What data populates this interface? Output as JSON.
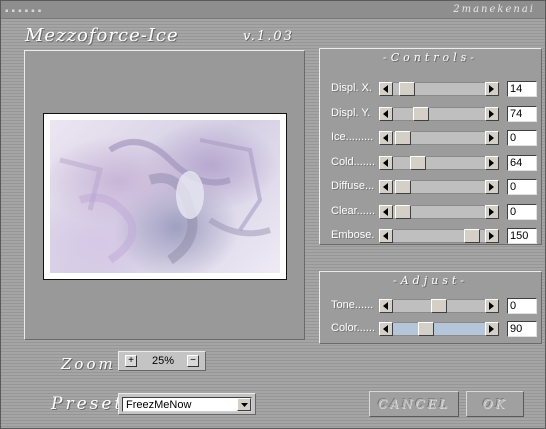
{
  "window": {
    "brand": "2manekenai",
    "title": "Mezzoforce-Ice",
    "version": "v.1.03"
  },
  "controls": {
    "title": "-Controls-",
    "rows": [
      {
        "label": "Displ. X.",
        "value": "14",
        "fraction": 0.14
      },
      {
        "label": "Displ. Y.",
        "value": "74",
        "fraction": 0.3
      },
      {
        "label": "Ice.........",
        "value": "0",
        "fraction": 0.1
      },
      {
        "label": "Cold.......",
        "value": "64",
        "fraction": 0.27
      },
      {
        "label": "Diffuse...",
        "value": "0",
        "fraction": 0.1
      },
      {
        "label": "Clear......",
        "value": "0",
        "fraction": 0.1
      },
      {
        "label": "Embose.",
        "value": "150",
        "fraction": 0.87
      }
    ]
  },
  "adjust": {
    "title": "-Adjust-",
    "rows": [
      {
        "label": "Tone......",
        "value": "0",
        "fraction": 0.5,
        "track": "default"
      },
      {
        "label": "Color......",
        "value": "90",
        "fraction": 0.35,
        "track": "color"
      }
    ]
  },
  "zoom": {
    "label": "Zoom",
    "value": "25%",
    "plus_label": "+",
    "minus_label": "−"
  },
  "preset": {
    "label": "Preset",
    "selected": "FreezMeNow"
  },
  "buttons": {
    "cancel": "CANCEL",
    "ok": "OK"
  },
  "colors": {
    "background": "#9a9a9a",
    "color_track": "#b6c6da"
  }
}
